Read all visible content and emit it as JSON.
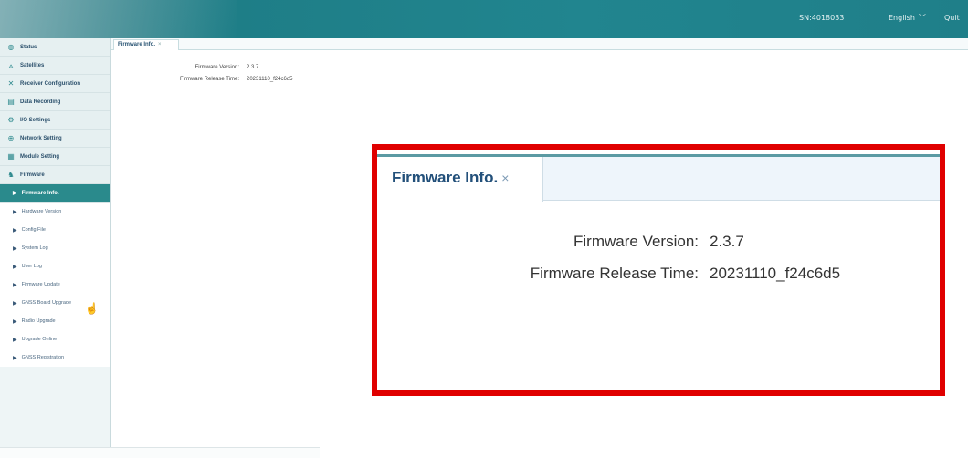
{
  "header": {
    "serial": "SN:4018033",
    "language": "English",
    "quit_label": "Quit"
  },
  "sidebar": {
    "items": [
      {
        "label": "Status",
        "icon": "status-icon",
        "glyph": "◍"
      },
      {
        "label": "Satellites",
        "icon": "satellite-icon",
        "glyph": "⟑"
      },
      {
        "label": "Receiver Configuration",
        "icon": "receiver-config-icon",
        "glyph": "✕"
      },
      {
        "label": "Data Recording",
        "icon": "data-recording-icon",
        "glyph": "▤"
      },
      {
        "label": "I/O Settings",
        "icon": "io-settings-icon",
        "glyph": "⚙"
      },
      {
        "label": "Network Setting",
        "icon": "network-icon",
        "glyph": "⊕"
      },
      {
        "label": "Module Setting",
        "icon": "module-icon",
        "glyph": "▦"
      },
      {
        "label": "Firmware",
        "icon": "firmware-icon",
        "glyph": "♞"
      }
    ],
    "firmware_sub": [
      {
        "label": "Firmware Info."
      },
      {
        "label": "Hardware Version"
      },
      {
        "label": "Config File"
      },
      {
        "label": "System Log"
      },
      {
        "label": "User Log"
      },
      {
        "label": "Firmware Update"
      },
      {
        "label": "GNSS Board Upgrade"
      },
      {
        "label": "Radio Upgrade"
      },
      {
        "label": "Upgrade Online"
      },
      {
        "label": "GNSS Registration"
      }
    ]
  },
  "main": {
    "tab_label": "Firmware Info.",
    "tab_close": "×",
    "firmware_version_label": "Firmware Version:",
    "firmware_version": "2.3.7",
    "release_time_label": "Firmware Release Time:",
    "release_time": "20231110_f24c6d5"
  },
  "colors": {
    "header": "#21858f",
    "active_item": "#2a8a8c",
    "callout_border": "#e00000"
  }
}
